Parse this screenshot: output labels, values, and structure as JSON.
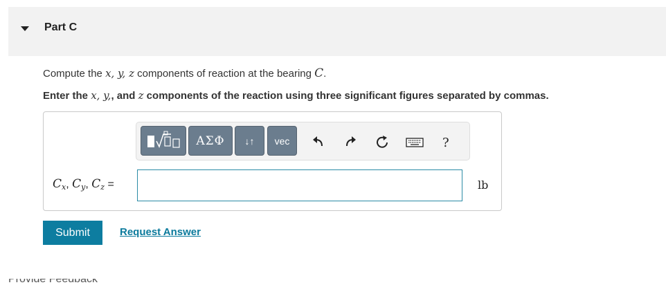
{
  "part": {
    "title": "Part C"
  },
  "question": {
    "compute_prefix": "Compute the ",
    "compute_suffix": " components of reaction at the bearing ",
    "bearing": "C",
    "period": ".",
    "vars_xyz": "x, y, z",
    "enter_prefix": "Enter the ",
    "enter_mid1": ", and ",
    "enter_suffix": " components of the reaction using three significant figures separated by commas.",
    "vars_xy": "x, y,",
    "var_z": "z"
  },
  "toolbar": {
    "templates_label": "▮√▢",
    "greek_label": "ΑΣΦ",
    "arrows_label": "↓↑",
    "vec_label": "vec",
    "help_label": "?",
    "icons": [
      "undo-icon",
      "redo-icon",
      "reset-icon",
      "keyboard-icon",
      "help-icon"
    ]
  },
  "answer": {
    "label_C": "C",
    "sub_x": "x",
    "sub_y": "y",
    "sub_z": "z",
    "sep": ", ",
    "equals": " =",
    "value": "",
    "unit": "lb"
  },
  "actions": {
    "submit_label": "Submit",
    "request_label": "Request Answer"
  },
  "footer": {
    "partial_text": "Provide Feedback"
  },
  "colors": {
    "accent": "#0d7da0",
    "toolbar_button": "#6b7d8e",
    "input_border": "#2a8aa5"
  }
}
